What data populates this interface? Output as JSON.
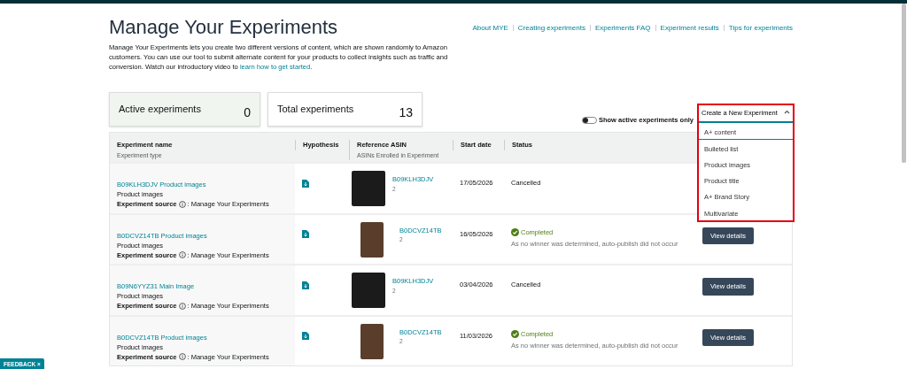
{
  "page": {
    "title": "Manage Your Experiments",
    "intro": "Manage Your Experiments lets you create two different versions of content, which are shown randomly to Amazon customers. You can use our tool to submit alternate content for your products to collect insights such as traffic and conversion. Watch our introductory video to ",
    "intro_link": "learn how to get started",
    "intro_end": "."
  },
  "help_links": [
    "About MYE",
    "Creating experiments",
    "Experiments FAQ",
    "Experiment results",
    "Tips for experiments"
  ],
  "stats": [
    {
      "label": "Active experiments",
      "value": "0",
      "selected": true
    },
    {
      "label": "Total experiments",
      "value": "13",
      "selected": false
    }
  ],
  "toggle": {
    "label": "Show active experiments only",
    "on": false
  },
  "create_menu": {
    "label": "Create a New Experiment",
    "expanded": true,
    "items": [
      {
        "label": "A+ content",
        "selected": true
      },
      {
        "label": "Bulleted list",
        "selected": false
      },
      {
        "label": "Product images",
        "selected": false
      },
      {
        "label": "Product title",
        "selected": false
      },
      {
        "label": "A+ Brand Story",
        "selected": false
      },
      {
        "label": "Multivariate",
        "selected": false
      }
    ]
  },
  "table": {
    "columns": [
      {
        "title": "Experiment name",
        "subtitle": "Experiment type"
      },
      {
        "title": "Hypothesis"
      },
      {
        "title": "Reference ASIN",
        "subtitle": "ASINs Enrolled in Experiment"
      },
      {
        "title": "Start date"
      },
      {
        "title": "Status"
      }
    ],
    "rows": [
      {
        "name": "B09KLH3DJV Product images",
        "type": "Product images",
        "source_label": "Experiment source",
        "source": ": Manage Your Experiments",
        "photo": {
          "kind": "cards"
        },
        "asin": "B09KLH3DJV",
        "asin_count": "2",
        "start_date": "17/05/2026",
        "status": "Cancelled",
        "kind": "cancelled"
      },
      {
        "name": "B0DCVZ14TB Product images",
        "type": "Product images",
        "source_label": "Experiment source",
        "source": ": Manage Your Experiments",
        "photo": {
          "kind": "wallet"
        },
        "asin": "B0DCVZ14TB",
        "asin_count": "2",
        "start_date": "16/05/2026",
        "status": "Completed",
        "kind": "completed",
        "status_note": "As no winner was determined, auto-publish did not occur",
        "action": "View details"
      },
      {
        "name": "B09N6YYZ31 Main Image",
        "type": "Product images",
        "source_label": "Experiment source",
        "source": ": Manage Your Experiments",
        "photo": {
          "kind": "cards"
        },
        "asin": "B09KLH3DJV",
        "asin_count": "2",
        "start_date": "03/04/2026",
        "status": "Cancelled",
        "kind": "cancelled",
        "action": "View details"
      },
      {
        "name": "B0DCVZ14TB Product images",
        "type": "Product images",
        "source_label": "Experiment source",
        "source": ": Manage Your Experiments",
        "photo": {
          "kind": "wallet"
        },
        "asin": "B0DCVZ14TB",
        "asin_count": "2",
        "start_date": "11/03/2026",
        "status": "Completed",
        "kind": "completed",
        "status_note": "As no winner was determined, auto-publish did not occur",
        "action": "View details"
      }
    ]
  },
  "feedback": {
    "label": "FEEDBACK",
    "close": "×"
  }
}
